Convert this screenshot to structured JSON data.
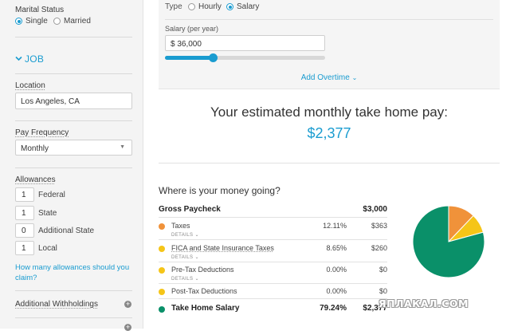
{
  "sidebar": {
    "marital_status": {
      "label": "Marital Status",
      "options": [
        "Single",
        "Married"
      ],
      "selected": "Single"
    },
    "job_section": {
      "label": "JOB",
      "chevron": "chevron-down-icon"
    },
    "location": {
      "label": "Location",
      "value": "Los Angeles, CA"
    },
    "pay_frequency": {
      "label": "Pay Frequency",
      "value": "Monthly"
    },
    "allowances": {
      "label": "Allowances",
      "items": [
        {
          "value": "1",
          "label": "Federal"
        },
        {
          "value": "1",
          "label": "State"
        },
        {
          "value": "0",
          "label": "Additional State"
        },
        {
          "value": "1",
          "label": "Local"
        }
      ]
    },
    "help_link": "How many allowances should you claim?",
    "additional_withholdings": "Additional Withholdings"
  },
  "salary_panel": {
    "type_label": "Type",
    "type_options": [
      "Hourly",
      "Salary"
    ],
    "type_selected": "Salary",
    "salary_label": "Salary (per year)",
    "salary_value": "$ 36,000",
    "slider_fraction": 0.3,
    "add_overtime": "Add Overtime"
  },
  "result": {
    "headline": "Your estimated monthly take home pay:",
    "amount": "$2,377"
  },
  "breakdown": {
    "question": "Where is your money going?",
    "gross": {
      "label": "Gross Paycheck",
      "amount": "$3,000"
    },
    "details_label": "DETAILS",
    "rows": [
      {
        "label": "Taxes",
        "percent": "12.11%",
        "amount": "$363",
        "color": "#f0923a"
      },
      {
        "label": "FICA and State Insurance Taxes",
        "percent": "8.65%",
        "amount": "$260",
        "color": "#f5c518"
      },
      {
        "label": "Pre-Tax Deductions",
        "percent": "0.00%",
        "amount": "$0",
        "color": "#f5c518"
      },
      {
        "label": "Post-Tax Deductions",
        "percent": "0.00%",
        "amount": "$0",
        "color": "#f5c518"
      },
      {
        "label": "Take Home Salary",
        "percent": "79.24%",
        "amount": "$2,377",
        "color": "#0a9069"
      }
    ]
  },
  "chart_data": {
    "type": "pie",
    "slices": [
      {
        "label": "Taxes",
        "value": 12.11,
        "color": "#f0923a"
      },
      {
        "label": "FICA and State Insurance Taxes",
        "value": 8.65,
        "color": "#f5c518"
      },
      {
        "label": "Pre-Tax Deductions",
        "value": 0,
        "color": "#f5c518"
      },
      {
        "label": "Post-Tax Deductions",
        "value": 0,
        "color": "#f5c518"
      },
      {
        "label": "Take Home Salary",
        "value": 79.24,
        "color": "#0a9069"
      }
    ]
  },
  "watermark": "ЯПЛАКАЛ.COM"
}
